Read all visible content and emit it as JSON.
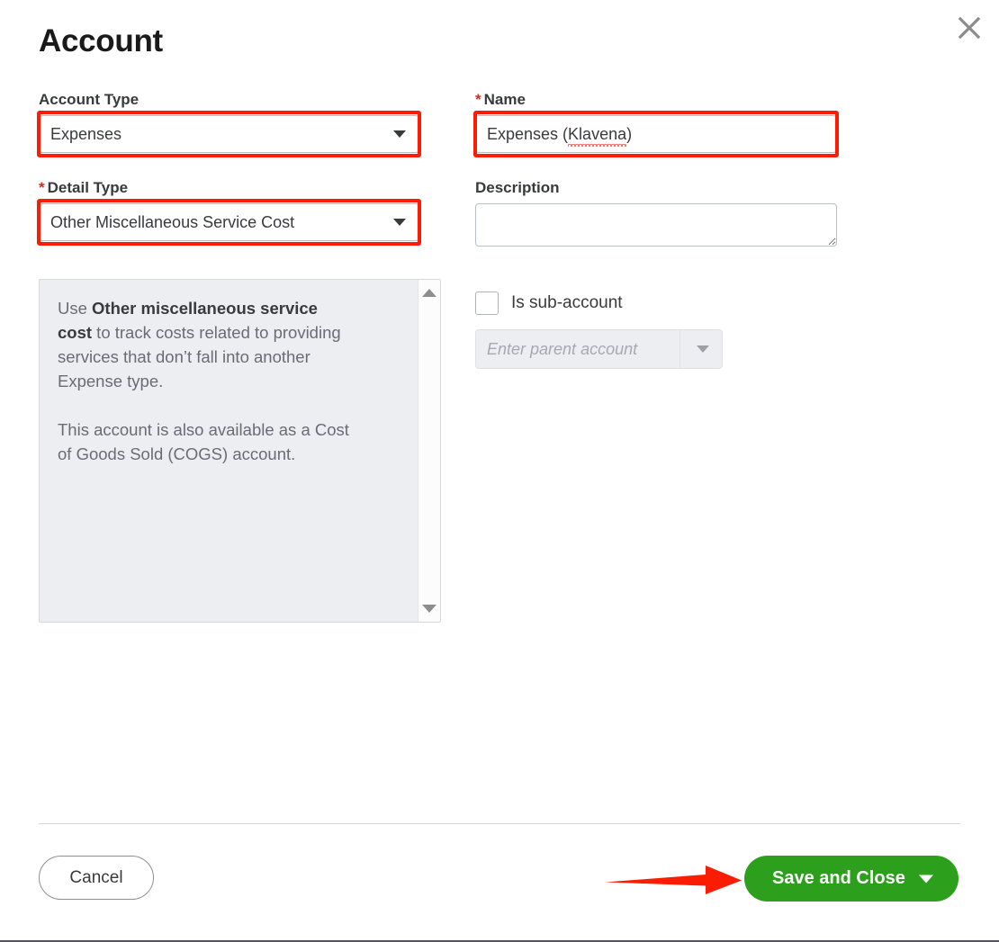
{
  "dialog": {
    "title": "Account",
    "close_icon": "close-x-icon"
  },
  "fields": {
    "account_type": {
      "label": "Account Type",
      "required": false,
      "value": "Expenses",
      "caret_icon": "chevron-down-icon"
    },
    "detail_type": {
      "label": "Detail Type",
      "required": true,
      "required_marker": "*",
      "value": "Other Miscellaneous Service Cost",
      "caret_icon": "chevron-down-icon"
    },
    "name": {
      "label": "Name",
      "required": true,
      "required_marker": "*",
      "value_prefix": "Expenses (",
      "value_misspelled": "Klavena",
      "value_suffix": ")",
      "value": "Expenses (Klavena)"
    },
    "description": {
      "label": "Description",
      "value": "",
      "placeholder": ""
    },
    "is_sub_account": {
      "label": "Is sub-account",
      "checked": false
    },
    "parent_account": {
      "placeholder": "Enter parent account",
      "value": "",
      "disabled": true,
      "caret_icon": "chevron-down-icon"
    }
  },
  "info_panel": {
    "paragraph_1_pre": "Use ",
    "paragraph_1_bold": "Other miscellaneous service cost",
    "paragraph_1_post": " to track costs related to providing services that don’t fall into another Expense type.",
    "paragraph_2": "This account is also available as a Cost of Goods Sold (COGS) account.",
    "scroll_up_icon": "scroll-up-arrow-icon",
    "scroll_down_icon": "scroll-down-arrow-icon"
  },
  "footer": {
    "cancel_label": "Cancel",
    "save_label": "Save and Close",
    "save_caret_icon": "chevron-down-icon"
  },
  "annotations": {
    "highlight_color": "#fb1c04",
    "arrow_color": "#fb1c04",
    "arrow_target": "save-and-close-button"
  },
  "colors": {
    "brand_green": "#2ca01c",
    "required_red": "#d52b1e",
    "text_dark": "#393a3d",
    "text_muted": "#6b6c72",
    "panel_bg": "#eceef1",
    "border": "#babec5"
  }
}
